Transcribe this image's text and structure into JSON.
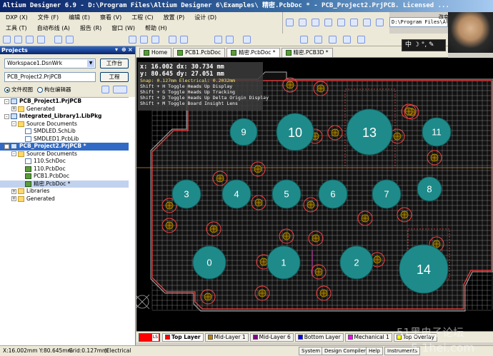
{
  "window": {
    "title": "Altium Designer 6.9 - D:\\Program Files\\Altium Designer 6\\Examples\\ 精密.PcbDoc * - PCB_Project2.PrjPCB. Licensed ..."
  },
  "menu": {
    "row1": [
      "DXP (X)",
      "文件 (F)",
      "编辑 (E)",
      "察看 (V)",
      "工程 (C)",
      "放置 (P)",
      "设计 (D)"
    ],
    "row2": [
      "工具 (T)",
      "自动布线 (A)",
      "报告 (R)",
      "窗口 (W)",
      "帮助 (H)"
    ]
  },
  "toolbar": {
    "path_value": "D:\\Program Files\\Altium Designer",
    "hint": "改变世界，下一个就是U"
  },
  "panel": {
    "title": "Projects",
    "workspace_value": "Workspace1.DsnWrk",
    "workspace_button": "工作台",
    "project_value": "PCB_Project2.PrjPCB",
    "project_button": "工程",
    "view_file": "文件视图",
    "view_struct": "构在编辑器",
    "tree": [
      {
        "label": "PCB_Project1.PrjPCB",
        "level": 0,
        "exp": "-",
        "icon": "proj",
        "bold": true
      },
      {
        "label": "Generated",
        "level": 1,
        "exp": "+",
        "icon": "folder"
      },
      {
        "label": "Integrated_Library1.LibPkg",
        "level": 0,
        "exp": "-",
        "icon": "proj",
        "bold": true
      },
      {
        "label": "Source Documents",
        "level": 1,
        "exp": "-",
        "icon": "folder"
      },
      {
        "label": "SMDLED.SchLib",
        "level": 2,
        "exp": "",
        "icon": "doc"
      },
      {
        "label": "SMDLED1.PcbLib",
        "level": 2,
        "exp": "",
        "icon": "doc"
      },
      {
        "label": "PCB_Project2.PrjPCB *",
        "level": 0,
        "exp": "-",
        "icon": "proj",
        "bold": true,
        "selected": true
      },
      {
        "label": "Source Documents",
        "level": 1,
        "exp": "-",
        "icon": "folder"
      },
      {
        "label": "110.SchDoc",
        "level": 2,
        "exp": "",
        "icon": "doc"
      },
      {
        "label": "110.PcbDoc",
        "level": 2,
        "exp": "",
        "icon": "pcb"
      },
      {
        "label": "PCB1.PcbDoc",
        "level": 2,
        "exp": "",
        "icon": "pcb"
      },
      {
        "label": "精密.PcbDoc *",
        "level": 2,
        "exp": "",
        "icon": "pcb",
        "light": true
      },
      {
        "label": "Libraries",
        "level": 1,
        "exp": "+",
        "icon": "folder"
      },
      {
        "label": "Generated",
        "level": 1,
        "exp": "+",
        "icon": "folder"
      }
    ]
  },
  "doc_tabs": [
    "Home",
    "PCB1.PcbDoc",
    "精密.PcbDoc *",
    "精密.PCB3D *"
  ],
  "info_overlay": {
    "line1": "x: 16.002   dx: 30.734 mm",
    "line2": "y: 80.645   dy: 27.051 mm",
    "line3": "Snap: 0.127mm Electrical: 0.2032mm",
    "line4": "Shift + H  Toggle Heads Up Display",
    "line5": "Shift + G  Toggle Heads Up Tracking",
    "line6": "Shift + D  Toggle Heads Up Delta Origin Display",
    "line7": "Shift + M  Toggle Board Insight Lens"
  },
  "ime": "中 ☽ °, ✎",
  "pads": [
    {
      "label": "9"
    },
    {
      "label": "10"
    },
    {
      "label": "13"
    },
    {
      "label": "11"
    },
    {
      "label": "3"
    },
    {
      "label": "4"
    },
    {
      "label": "5"
    },
    {
      "label": "6"
    },
    {
      "label": "7"
    },
    {
      "label": "8"
    },
    {
      "label": "0"
    },
    {
      "label": "1"
    },
    {
      "label": "2"
    },
    {
      "label": "14"
    }
  ],
  "layer_tabs": {
    "ls": "LS",
    "items": [
      {
        "label": "Top Layer",
        "color": "#ff0000"
      },
      {
        "label": "Mid-Layer 1",
        "color": "#b8860b"
      },
      {
        "label": "Mid-Layer 6",
        "color": "#800080"
      },
      {
        "label": "Bottom Layer",
        "color": "#0000ff"
      },
      {
        "label": "Mechanical 1",
        "color": "#ff00ff"
      },
      {
        "label": "Top Overlay",
        "color": "#ffff00"
      }
    ]
  },
  "status": {
    "coords": "X:16.002mm Y:80.645mm",
    "grid": "Grid:0.127mm",
    "mode": "(Electrical",
    "buttons": [
      "System",
      "Design Compiler",
      "Help",
      "Instruments"
    ]
  },
  "watermark": "51黑电子论坛",
  "watermark2": "5 1hei.com",
  "colors": {
    "pad_fill": "#1f8a8a",
    "grid": "#c8c8c8",
    "board": "#1a1a1a",
    "outline": "#ff4040"
  }
}
